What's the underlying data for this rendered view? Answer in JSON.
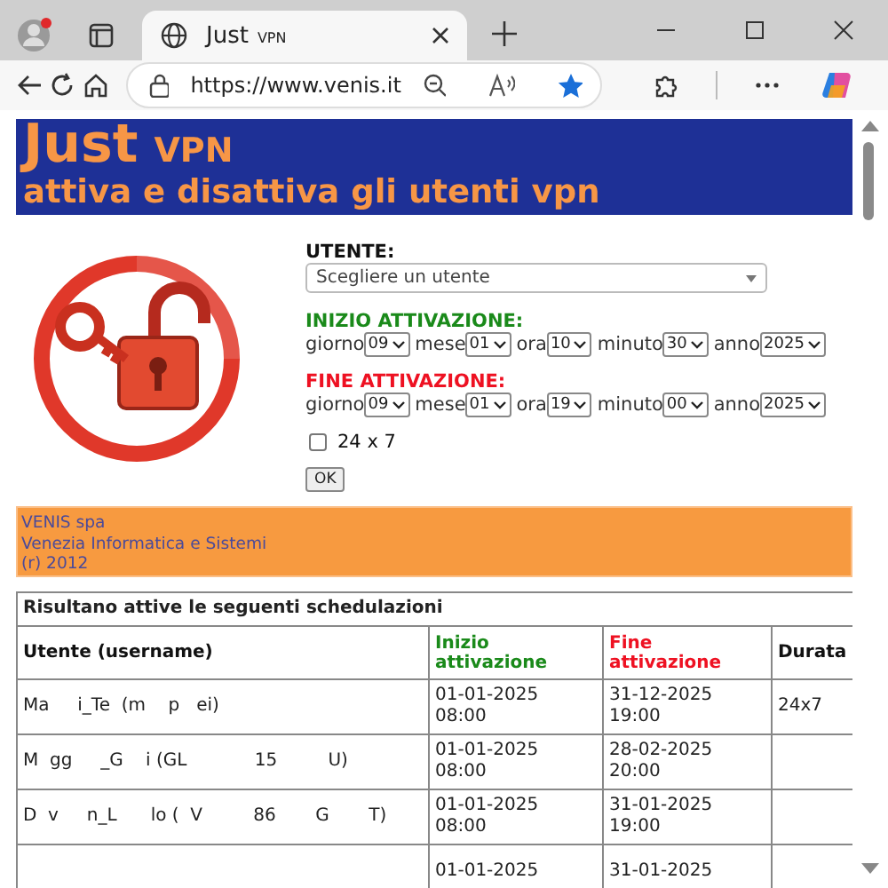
{
  "browser": {
    "tab": {
      "title": "Just",
      "title_small": "VPN",
      "selected": true
    },
    "address": "https://www.venis.it"
  },
  "header": {
    "title": "Just",
    "title_small": "VPN",
    "subtitle": "attiva e disattiva gli utenti vpn"
  },
  "form": {
    "user_label": "UTENTE:",
    "user_select": {
      "placeholder": "Scegliere un utente"
    },
    "periods": [
      {
        "kind": "start",
        "title": "INIZIO ATTIVAZIONE:",
        "fields": [
          {
            "label": "giorno",
            "value": "09"
          },
          {
            "label": "mese",
            "value": "01"
          },
          {
            "label": "ora",
            "value": "10"
          },
          {
            "label": "minuto",
            "value": "30"
          },
          {
            "label": "anno",
            "value": "2025"
          }
        ]
      },
      {
        "kind": "end",
        "title": "FINE ATTIVAZIONE:",
        "fields": [
          {
            "label": "giorno",
            "value": "09"
          },
          {
            "label": "mese",
            "value": "01"
          },
          {
            "label": "ora",
            "value": "19"
          },
          {
            "label": "minuto",
            "value": "00"
          },
          {
            "label": "anno",
            "value": "2025"
          }
        ]
      }
    ],
    "always": {
      "label": "24 x 7",
      "checked": false
    },
    "submit": "OK"
  },
  "footer": {
    "lines": [
      "VENIS spa",
      "Venezia Informatica e Sistemi",
      "(r) 2012"
    ]
  },
  "table": {
    "caption": "Risultano attive le seguenti schedulazioni",
    "columns": [
      {
        "label": "Utente (username)",
        "kind": "plain"
      },
      {
        "label": "Inizio attivazione",
        "kind": "start"
      },
      {
        "label": "Fine attivazione",
        "kind": "end"
      },
      {
        "label": "Durata",
        "kind": "plain"
      }
    ],
    "rows": [
      {
        "user": "Ma     i_Te  (m    p   ei)",
        "start": [
          "01-01-2025",
          "08:00"
        ],
        "end": [
          "31-12-2025",
          "19:00"
        ],
        "duration": "24x7"
      },
      {
        "user": "M  gg     _G    i (GL            15         U)",
        "start": [
          "01-01-2025",
          "08:00"
        ],
        "end": [
          "28-02-2025",
          "20:00"
        ]
      },
      {
        "user": "D  v     n_L      lo (  V         86       G       T)",
        "start": [
          "01-01-2025",
          "08:00"
        ],
        "end": [
          "31-01-2025",
          "19:00"
        ]
      },
      {
        "start": [
          "01-01-2025"
        ],
        "end": [
          "31-01-2025"
        ]
      }
    ]
  }
}
